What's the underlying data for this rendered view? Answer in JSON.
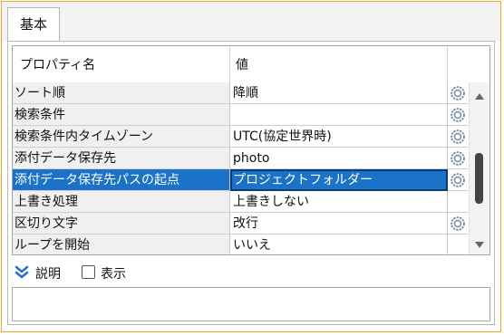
{
  "tabs": [
    {
      "label": "基本"
    }
  ],
  "table": {
    "header": {
      "name": "プロパティ名",
      "value": "値"
    },
    "rows": [
      {
        "name": "ソート順",
        "value": "降順",
        "has_button": true,
        "selected": false
      },
      {
        "name": "検索条件",
        "value": "",
        "has_button": true,
        "selected": false
      },
      {
        "name": "検索条件内タイムゾーン",
        "value": "UTC(協定世界時)",
        "has_button": true,
        "selected": false
      },
      {
        "name": "添付データ保存先",
        "value": "photo",
        "has_button": true,
        "selected": false
      },
      {
        "name": "添付データ保存先パスの起点",
        "value": "プロジェクトフォルダー",
        "has_button": true,
        "selected": true
      },
      {
        "name": "上書き処理",
        "value": "上書きしない",
        "has_button": false,
        "selected": false
      },
      {
        "name": "区切り文字",
        "value": "改行",
        "has_button": true,
        "selected": false
      },
      {
        "name": "ループを開始",
        "value": "いいえ",
        "has_button": false,
        "selected": false
      }
    ],
    "scroll_position": 0.45
  },
  "description": {
    "label": "説明",
    "show_label": "表示",
    "show_checked": false,
    "text": ""
  },
  "colors": {
    "accent_border": "#f5a623",
    "selection": "#1a73c9"
  },
  "icons": {
    "row_button": "ellipsis-gear-icon",
    "description_toggle": "double-chevron-down-icon"
  }
}
